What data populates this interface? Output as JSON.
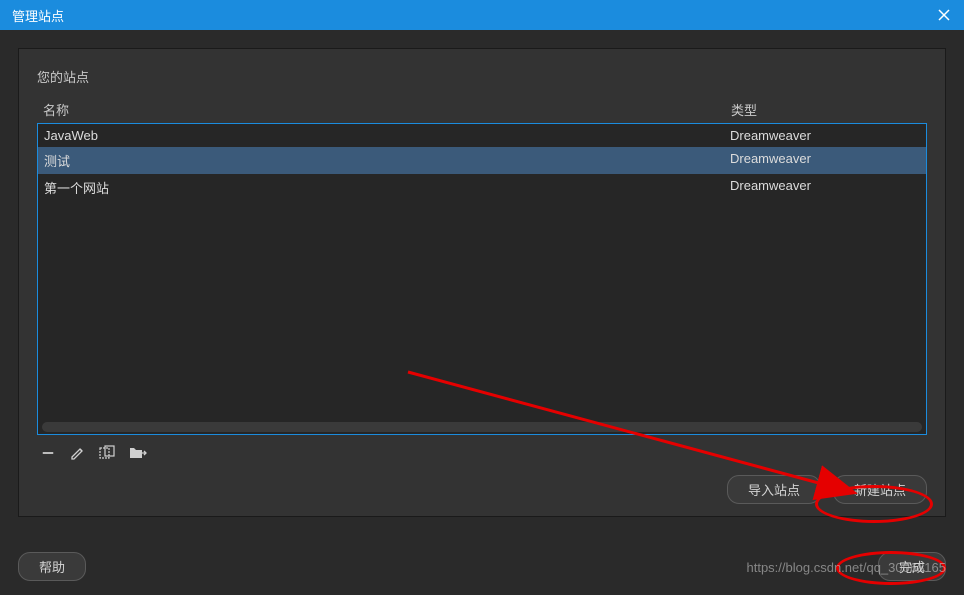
{
  "titlebar": {
    "title": "管理站点"
  },
  "panel": {
    "heading": "您的站点",
    "columns": {
      "name": "名称",
      "type": "类型"
    },
    "rows": [
      {
        "name": "JavaWeb",
        "type": "Dreamweaver",
        "selected": false
      },
      {
        "name": "测试",
        "type": "Dreamweaver",
        "selected": true
      },
      {
        "name": "第一个网站",
        "type": "Dreamweaver",
        "selected": false
      }
    ],
    "buttons": {
      "import": "导入站点",
      "new": "新建站点"
    }
  },
  "footer": {
    "help": "帮助",
    "done": "完成"
  },
  "watermark": "https://blog.csdn.net/qq_30068165"
}
